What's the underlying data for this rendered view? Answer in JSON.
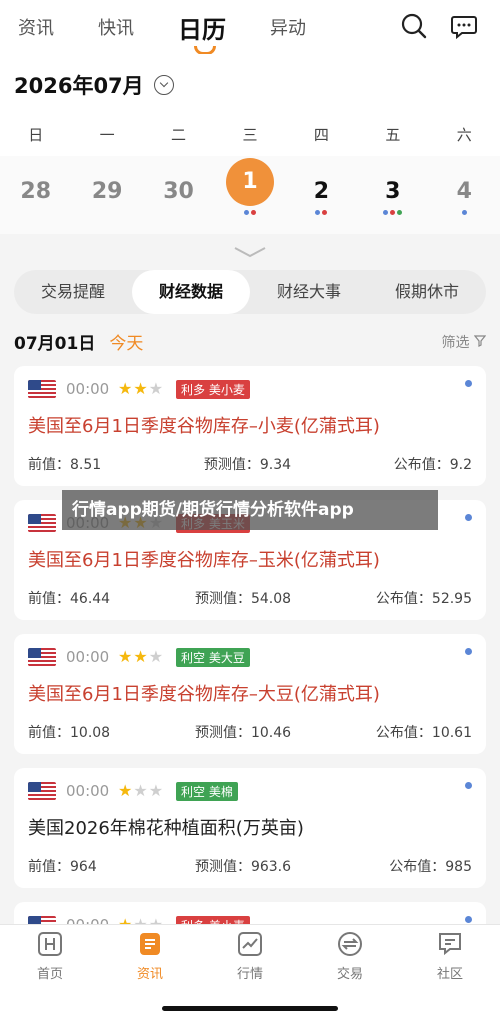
{
  "top_tabs": [
    "资讯",
    "快讯",
    "日历",
    "异动"
  ],
  "top_active": 2,
  "calendar": {
    "month_label": "2026年07月",
    "weekdays": [
      "日",
      "一",
      "二",
      "三",
      "四",
      "五",
      "六"
    ],
    "days": [
      {
        "num": "28",
        "dots": []
      },
      {
        "num": "29",
        "dots": []
      },
      {
        "num": "30",
        "dots": []
      },
      {
        "num": "1",
        "dots": [
          "#5b86d6",
          "#d94040"
        ]
      },
      {
        "num": "2",
        "dots": [
          "#5b86d6",
          "#d94040"
        ]
      },
      {
        "num": "3",
        "dots": [
          "#5b86d6",
          "#d94040",
          "#3fa354"
        ]
      },
      {
        "num": "4",
        "dots": [
          "#5b86d6"
        ]
      }
    ],
    "selected_day": 3
  },
  "segments": [
    "交易提醒",
    "财经数据",
    "财经大事",
    "假期休市"
  ],
  "segment_active": 1,
  "date_line": {
    "date": "07月01日",
    "today": "今天",
    "filter": "筛选"
  },
  "banner_text": "行情app期货/期货行情分析软件app",
  "cards": [
    {
      "time": "00:00",
      "stars": 2,
      "tag": "利多 美小麦",
      "tag_color": "red",
      "title": "美国至6月1日季度谷物库存–小麦(亿蒲式耳)",
      "title_color": "red",
      "prev": "前值：8.51",
      "forecast": "预测值：9.34",
      "actual": "公布值：9.2"
    },
    {
      "time": "00:00",
      "stars": 2,
      "tag": "利多 美玉米",
      "tag_color": "red",
      "title": "美国至6月1日季度谷物库存–玉米(亿蒲式耳)",
      "title_color": "red",
      "prev": "前值：46.44",
      "forecast": "预测值：54.08",
      "actual": "公布值：52.95"
    },
    {
      "time": "00:00",
      "stars": 2,
      "tag": "利空 美大豆",
      "tag_color": "green",
      "title": "美国至6月1日季度谷物库存–大豆(亿蒲式耳)",
      "title_color": "red",
      "prev": "前值：10.08",
      "forecast": "预测值：10.46",
      "actual": "公布值：10.61"
    },
    {
      "time": "00:00",
      "stars": 1,
      "tag": "利空 美棉",
      "tag_color": "green",
      "title": "美国2026年棉花种植面积(万英亩)",
      "title_color": "black",
      "prev": "前值：964",
      "forecast": "预测值：963.6",
      "actual": "公布值：985"
    },
    {
      "time": "00:00",
      "stars": 1,
      "tag": "利多 美小麦",
      "tag_color": "red",
      "title": "",
      "title_color": "red",
      "prev": "",
      "forecast": "",
      "actual": ""
    }
  ],
  "bottom_tabs": [
    {
      "label": "首页",
      "icon": "home-icon"
    },
    {
      "label": "资讯",
      "icon": "news-icon"
    },
    {
      "label": "行情",
      "icon": "chart-icon"
    },
    {
      "label": "交易",
      "icon": "trade-icon"
    },
    {
      "label": "社区",
      "icon": "community-icon"
    }
  ],
  "bottom_active": 1,
  "colors": {
    "accent": "#f08a24",
    "bullish": "#d94040",
    "bearish": "#3fa354"
  }
}
